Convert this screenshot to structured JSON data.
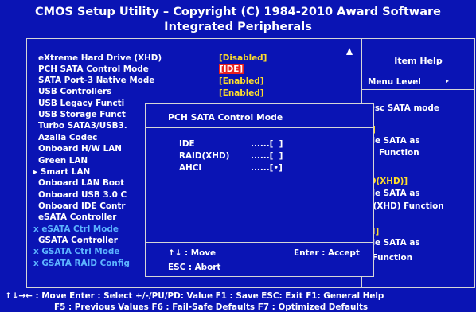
{
  "header": {
    "title_line1": "CMOS Setup Utility – Copyright (C) 1984-2010 Award Software",
    "title_line2": "Integrated Peripherals"
  },
  "menu_items": [
    {
      "label": "eXtreme Hard Drive (XHD)",
      "value": "[Disabled]"
    },
    {
      "label": "PCH SATA Control Mode",
      "value": "[IDE]"
    },
    {
      "label": "SATA Port-3 Native Mode",
      "value": "[Enabled]"
    },
    {
      "label": "USB Controllers",
      "value": "[Enabled]"
    },
    {
      "label": "USB Legacy Functi"
    },
    {
      "label": "USB Storage Funct"
    },
    {
      "label": "Turbo SATA3/USB3."
    },
    {
      "label": "Azalia Codec"
    },
    {
      "label": "Onboard H/W LAN"
    },
    {
      "label": "Green LAN"
    },
    {
      "label": "▸ Smart LAN"
    },
    {
      "label": "Onboard LAN Boot"
    },
    {
      "label": "Onboard USB 3.0 C"
    },
    {
      "label": "Onboard IDE Contr"
    },
    {
      "label": "eSATA Controller"
    },
    {
      "label": "x eSATA Ctrl Mode"
    },
    {
      "label": "GSATA Controller"
    },
    {
      "label": "x GSATA Ctrl Mode"
    },
    {
      "label": "x GSATA RAID Config"
    }
  ],
  "help": {
    "title": "Item Help",
    "menu_level": "Menu Level",
    "menu_level_arrow": "▸",
    "lines": [
      "Osc SATA mode",
      "E]",
      "ble SATA as",
      "Function",
      "ID(XHD)]",
      "ble SATA as",
      "D(XHD) Function",
      "CI]",
      "ble SATA as",
      "I Function"
    ]
  },
  "popup": {
    "title": "PCH SATA Control Mode",
    "options": [
      {
        "label": "IDE",
        "mark": "......[  ]"
      },
      {
        "label": "RAID(XHD)",
        "mark": "......[  ]"
      },
      {
        "label": "AHCI",
        "mark": "......[•]"
      }
    ],
    "foot_move": "↑↓ : Move",
    "foot_enter": "Enter : Accept",
    "foot_esc": "ESC  : Abort"
  },
  "footer": {
    "line1": "↑↓→← : Move   Enter : Select   +/-/PU/PD: Value   F1 : Save   ESC: Exit   F1: General Help",
    "line2": "F5 : Previous Values     F6 : Fail-Safe Defaults       F7 : Optimized Defaults"
  },
  "colors": {
    "background": "#0a14b4",
    "value_yellow": "#ffde2a",
    "selected_red": "#e8201e",
    "disabled_blue": "#5db4ff"
  }
}
